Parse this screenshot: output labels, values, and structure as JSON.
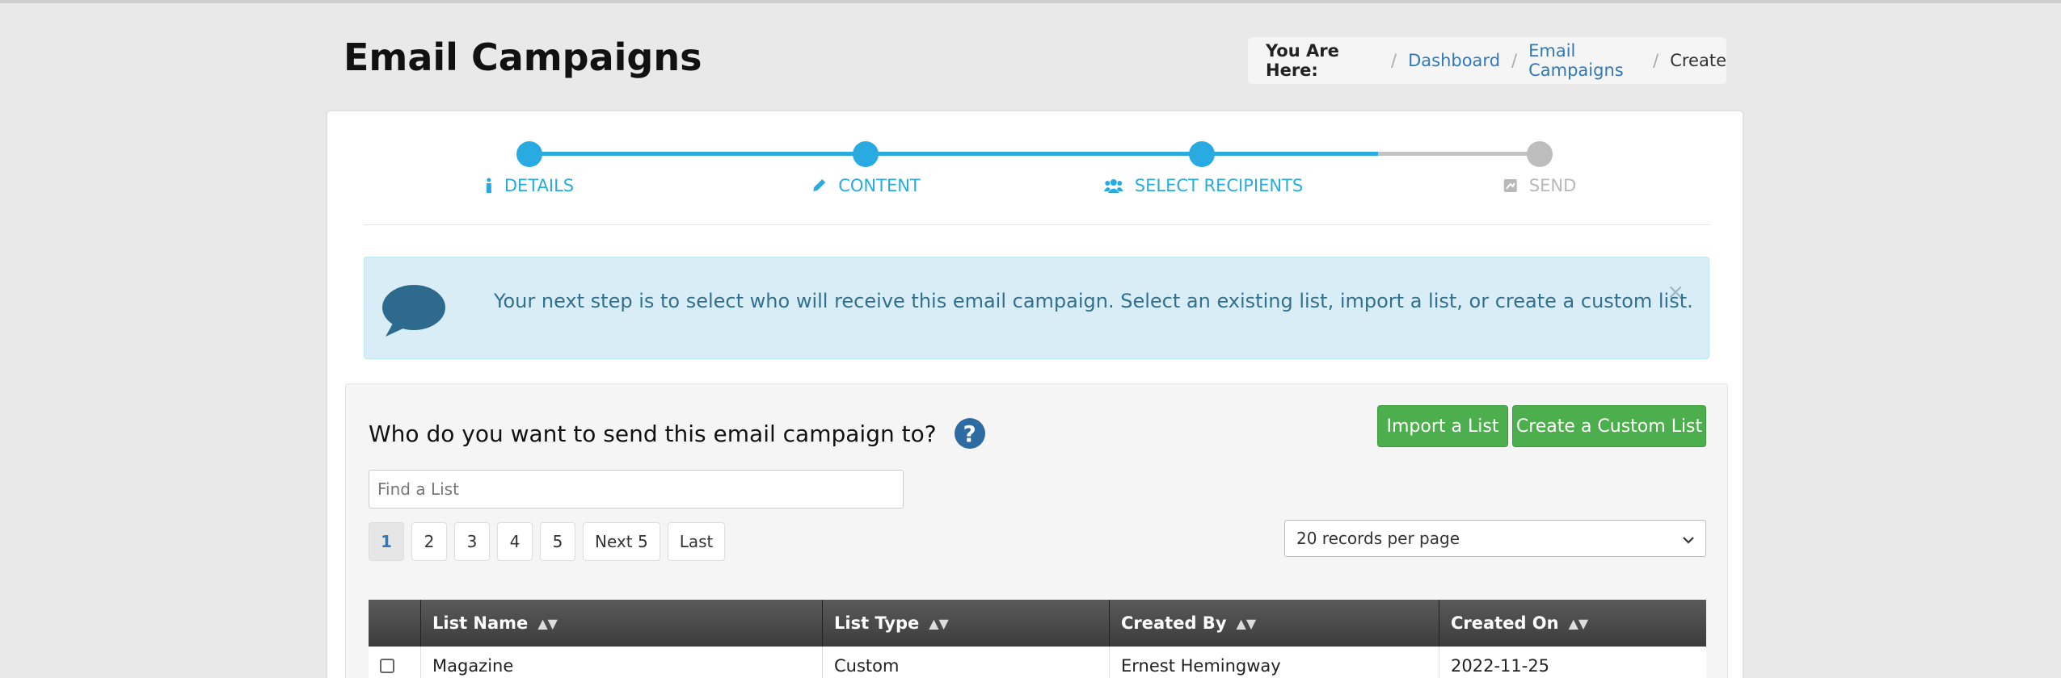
{
  "header": {
    "title": "Email Campaigns"
  },
  "breadcrumb": {
    "label": "You Are Here:",
    "items": [
      "Dashboard",
      "Email Campaigns",
      "Create"
    ]
  },
  "wizard": {
    "steps": [
      {
        "label": "DETAILS",
        "icon": "info-icon",
        "state": "active"
      },
      {
        "label": "CONTENT",
        "icon": "pencil-icon",
        "state": "active"
      },
      {
        "label": "SELECT RECIPIENTS",
        "icon": "users-icon",
        "state": "active"
      },
      {
        "label": "SEND",
        "icon": "send-icon",
        "state": "inactive"
      }
    ],
    "active_color": "#29abe2",
    "inactive_color": "#bdbdbd"
  },
  "alert": {
    "message": "Your next step is to select who will receive this email campaign. Select an existing list, import a list, or create a custom list.",
    "close": "×"
  },
  "recipients": {
    "question": "Who do you want to send this email campaign to?",
    "help": "?",
    "import_button": "Import a List",
    "custom_button": "Create a Custom List",
    "search_placeholder": "Find a List",
    "pagination": [
      "1",
      "2",
      "3",
      "4",
      "5",
      "Next 5",
      "Last"
    ],
    "per_page": "20 records per page"
  },
  "table": {
    "columns": [
      "List Name",
      "List Type",
      "Created By",
      "Created On"
    ],
    "rows": [
      {
        "name": "Magazine",
        "type": "Custom",
        "created_by": "Ernest Hemingway",
        "created_on": "2022-11-25"
      }
    ]
  }
}
